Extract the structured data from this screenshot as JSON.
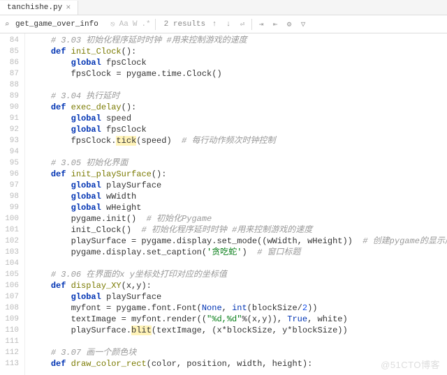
{
  "tab": {
    "filename": "tanchishe.py"
  },
  "find": {
    "query": "get_game_over_info",
    "opt_case": "Cc",
    "opt_word": "W",
    "opt_regex": ".*",
    "opt_aa": "Aa",
    "results_text": "2 results",
    "prev": "↑",
    "next": "↓",
    "select_all": "⏎",
    "more1": "⇥",
    "more2": "⇤",
    "settings": "⚙",
    "filter": "▽",
    "close": "×"
  },
  "gutter_start": 84,
  "lines": [
    {
      "i": 1,
      "segs": [
        {
          "t": "# 3.03 初始化程序延时时钟 #用来控制游戏的速度",
          "cls": "c"
        }
      ]
    },
    {
      "i": 1,
      "segs": [
        {
          "t": "def ",
          "cls": "kw"
        },
        {
          "t": "init_Clock",
          "cls": "fn"
        },
        {
          "t": "():",
          "cls": "id"
        }
      ]
    },
    {
      "i": 2,
      "segs": [
        {
          "t": "global ",
          "cls": "kw"
        },
        {
          "t": "fpsClock",
          "cls": "id"
        }
      ]
    },
    {
      "i": 2,
      "segs": [
        {
          "t": "fpsClock = pygame.time.Clock()",
          "cls": "id"
        }
      ]
    },
    {
      "i": 0,
      "segs": []
    },
    {
      "i": 1,
      "segs": [
        {
          "t": "# 3.04 执行延时",
          "cls": "c"
        }
      ]
    },
    {
      "i": 1,
      "segs": [
        {
          "t": "def ",
          "cls": "kw"
        },
        {
          "t": "exec_delay",
          "cls": "fn"
        },
        {
          "t": "():",
          "cls": "id"
        }
      ]
    },
    {
      "i": 2,
      "segs": [
        {
          "t": "global ",
          "cls": "kw"
        },
        {
          "t": "speed",
          "cls": "id"
        }
      ]
    },
    {
      "i": 2,
      "segs": [
        {
          "t": "global ",
          "cls": "kw"
        },
        {
          "t": "fpsClock",
          "cls": "id"
        }
      ]
    },
    {
      "i": 2,
      "segs": [
        {
          "t": "fpsClock.",
          "cls": "id"
        },
        {
          "t": "tick",
          "cls": "hl"
        },
        {
          "t": "(speed)  ",
          "cls": "id"
        },
        {
          "t": "# 每行动作频次时钟控制",
          "cls": "c"
        }
      ]
    },
    {
      "i": 0,
      "segs": []
    },
    {
      "i": 1,
      "segs": [
        {
          "t": "# 3.05 初始化界面",
          "cls": "c"
        }
      ]
    },
    {
      "i": 1,
      "segs": [
        {
          "t": "def ",
          "cls": "kw"
        },
        {
          "t": "init_playSurface",
          "cls": "fn"
        },
        {
          "t": "():",
          "cls": "id"
        }
      ]
    },
    {
      "i": 2,
      "segs": [
        {
          "t": "global ",
          "cls": "kw"
        },
        {
          "t": "playSurface",
          "cls": "id"
        }
      ]
    },
    {
      "i": 2,
      "segs": [
        {
          "t": "global ",
          "cls": "kw"
        },
        {
          "t": "wWidth",
          "cls": "id"
        }
      ]
    },
    {
      "i": 2,
      "segs": [
        {
          "t": "global ",
          "cls": "kw"
        },
        {
          "t": "wHeight",
          "cls": "id"
        }
      ]
    },
    {
      "i": 2,
      "segs": [
        {
          "t": "pygame.init()  ",
          "cls": "id"
        },
        {
          "t": "# 初始化Pygame",
          "cls": "c"
        }
      ]
    },
    {
      "i": 2,
      "segs": [
        {
          "t": "init_Clock()  ",
          "cls": "id"
        },
        {
          "t": "# 初始化程序延时时钟 #用来控制游戏的速度",
          "cls": "c"
        }
      ]
    },
    {
      "i": 2,
      "segs": [
        {
          "t": "playSurface = pygame.display.set_mode((wWidth, wHeight))  ",
          "cls": "id"
        },
        {
          "t": "# 创建pygame的显示层",
          "cls": "c"
        }
      ]
    },
    {
      "i": 2,
      "segs": [
        {
          "t": "pygame.display.set_caption(",
          "cls": "id"
        },
        {
          "t": "'贪吃蛇'",
          "cls": "s"
        },
        {
          "t": ")  ",
          "cls": "id"
        },
        {
          "t": "# 窗口标题",
          "cls": "c"
        }
      ]
    },
    {
      "i": 0,
      "segs": []
    },
    {
      "i": 1,
      "segs": [
        {
          "t": "# 3.06 在界面的x y坐标处打印对应的坐标值",
          "cls": "c"
        }
      ]
    },
    {
      "i": 1,
      "segs": [
        {
          "t": "def ",
          "cls": "kw"
        },
        {
          "t": "display_XY",
          "cls": "fn"
        },
        {
          "t": "(x,y):",
          "cls": "id"
        }
      ]
    },
    {
      "i": 2,
      "segs": [
        {
          "t": "global ",
          "cls": "kw"
        },
        {
          "t": "playSurface",
          "cls": "id"
        }
      ]
    },
    {
      "i": 2,
      "segs": [
        {
          "t": "myfont = pygame.font.Font(",
          "cls": "id"
        },
        {
          "t": "None",
          "cls": "b"
        },
        {
          "t": ", ",
          "cls": "id"
        },
        {
          "t": "int",
          "cls": "b"
        },
        {
          "t": "(blockSize/",
          "cls": "id"
        },
        {
          "t": "2",
          "cls": "n"
        },
        {
          "t": "))",
          "cls": "id"
        }
      ]
    },
    {
      "i": 2,
      "segs": [
        {
          "t": "textImage = myfont.render((",
          "cls": "id"
        },
        {
          "t": "\"%d,%d\"",
          "cls": "s"
        },
        {
          "t": "%(x,y)), ",
          "cls": "id"
        },
        {
          "t": "True",
          "cls": "b"
        },
        {
          "t": ", white)",
          "cls": "id"
        }
      ]
    },
    {
      "i": 2,
      "segs": [
        {
          "t": "playSurface.",
          "cls": "id"
        },
        {
          "t": "blit",
          "cls": "hl"
        },
        {
          "t": "(textImage, (x*blockSize, y*blockSize))",
          "cls": "id"
        }
      ]
    },
    {
      "i": 0,
      "segs": []
    },
    {
      "i": 1,
      "segs": [
        {
          "t": "# 3.07 画一个颜色块",
          "cls": "c"
        }
      ]
    },
    {
      "i": 1,
      "segs": [
        {
          "t": "def ",
          "cls": "kw"
        },
        {
          "t": "draw_color_rect",
          "cls": "fn"
        },
        {
          "t": "(color, position, width, height):",
          "cls": "id"
        }
      ]
    }
  ],
  "watermark": "@51CTO博客"
}
